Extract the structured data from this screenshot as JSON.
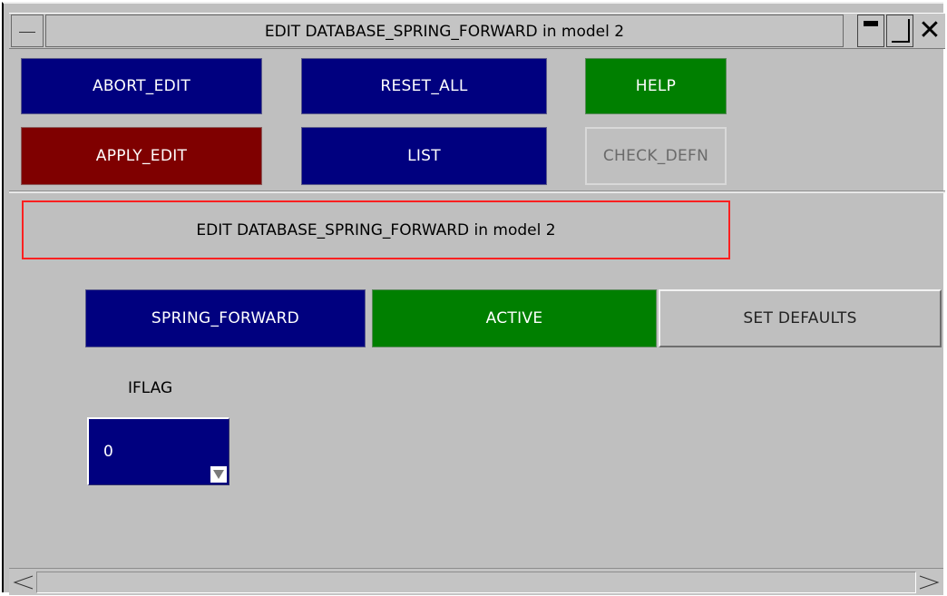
{
  "window": {
    "title": "EDIT DATABASE_SPRING_FORWARD in model 2"
  },
  "toolbar": {
    "abort_edit": "ABORT_EDIT",
    "reset_all": "RESET_ALL",
    "help": "HELP",
    "apply_edit": "APPLY_EDIT",
    "list": "LIST",
    "check_defn": "CHECK_DEFN"
  },
  "header": {
    "info": "EDIT DATABASE_SPRING_FORWARD in model 2"
  },
  "card": {
    "keyword": "SPRING_FORWARD",
    "status": "ACTIVE",
    "set_defaults": "SET DEFAULTS"
  },
  "fields": {
    "iflag_label": "IFLAG",
    "iflag_value": "0"
  },
  "colors": {
    "navy": "#00007f",
    "green": "#007f00",
    "maroon": "#7f0000",
    "panel": "#bfbfbf",
    "highlight_border": "#ff2020"
  },
  "icons": {
    "system_menu": "system-menu-icon",
    "minimize": "minimize-icon",
    "maximize": "maximize-icon",
    "close": "close-icon",
    "dropdown": "dropdown-arrow-icon"
  }
}
